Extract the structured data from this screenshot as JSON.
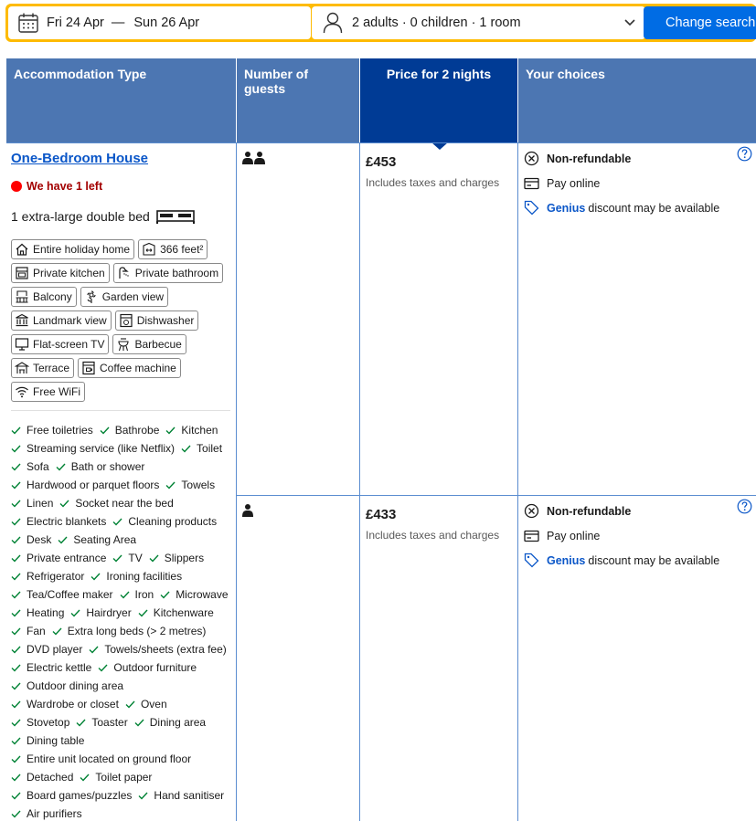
{
  "search": {
    "date_from": "Fri 24 Apr",
    "date_sep": "—",
    "date_to": "Sun 26 Apr",
    "guests": "2 adults · 0 children · 1 room",
    "button": "Change search"
  },
  "colors": {
    "header": "#4c76b2",
    "header_selected": "#003b95",
    "button": "#006ce4",
    "search_border": "#febb02",
    "link": "#0a56c8",
    "alert": "#a30000"
  },
  "table": {
    "headers": [
      "Accommodation Type",
      "Number of guests",
      "Price for 2 nights",
      "Your choices"
    ]
  },
  "room": {
    "name": "One-Bedroom House",
    "availability": "We have 1 left",
    "bed": "1 extra-large double bed",
    "facilities": [
      [
        {
          "icon": "home-icon",
          "label": "Entire holiday home"
        },
        {
          "icon": "size-icon",
          "label": "366 feet²"
        }
      ],
      [
        {
          "icon": "kitchen-icon",
          "label": "Private kitchen"
        },
        {
          "icon": "shower-icon",
          "label": "Private bathroom"
        }
      ],
      [
        {
          "icon": "balcony-icon",
          "label": "Balcony"
        },
        {
          "icon": "flower-icon",
          "label": "Garden view"
        }
      ],
      [
        {
          "icon": "landmark-icon",
          "label": "Landmark view"
        },
        {
          "icon": "dishwasher-icon",
          "label": "Dishwasher"
        }
      ],
      [
        {
          "icon": "tv-icon",
          "label": "Flat-screen TV"
        },
        {
          "icon": "barbecue-icon",
          "label": "Barbecue"
        }
      ],
      [
        {
          "icon": "terrace-icon",
          "label": "Terrace"
        },
        {
          "icon": "coffee-machine-icon",
          "label": "Coffee machine"
        }
      ],
      [
        {
          "icon": "wifi-icon",
          "label": "Free WiFi"
        }
      ]
    ],
    "amenities": [
      [
        "Free toiletries",
        "Bathrobe",
        "Kitchen"
      ],
      [
        "Streaming service (like Netflix)",
        "Toilet"
      ],
      [
        "Sofa",
        "Bath or shower"
      ],
      [
        "Hardwood or parquet floors",
        "Towels"
      ],
      [
        "Linen",
        "Socket near the bed"
      ],
      [
        "Electric blankets",
        "Cleaning products"
      ],
      [
        "Desk",
        "Seating Area"
      ],
      [
        "Private entrance",
        "TV",
        "Slippers"
      ],
      [
        "Refrigerator",
        "Ironing facilities"
      ],
      [
        "Tea/Coffee maker",
        "Iron",
        "Microwave"
      ],
      [
        "Heating",
        "Hairdryer",
        "Kitchenware"
      ],
      [
        "Fan",
        "Extra long beds (> 2 metres)"
      ],
      [
        "DVD player",
        "Towels/sheets (extra fee)"
      ],
      [
        "Electric kettle",
        "Outdoor furniture"
      ],
      [
        "Outdoor dining area"
      ],
      [
        "Wardrobe or closet",
        "Oven"
      ],
      [
        "Stovetop",
        "Toaster",
        "Dining area"
      ],
      [
        "Dining table"
      ],
      [
        "Entire unit located on ground floor"
      ],
      [
        "Detached",
        "Toilet paper"
      ],
      [
        "Board games/puzzles",
        "Hand sanitiser"
      ],
      [
        "Air purifiers"
      ]
    ]
  },
  "options": [
    {
      "guests": 2,
      "price": "£453",
      "tax": "Includes taxes and charges",
      "refund": "Non-refundable",
      "payment": "Pay online",
      "genius": "Genius",
      "genius_text": "discount may be available"
    },
    {
      "guests": 1,
      "price": "£433",
      "tax": "Includes taxes and charges",
      "refund": "Non-refundable",
      "payment": "Pay online",
      "genius": "Genius",
      "genius_text": "discount may be available"
    }
  ]
}
